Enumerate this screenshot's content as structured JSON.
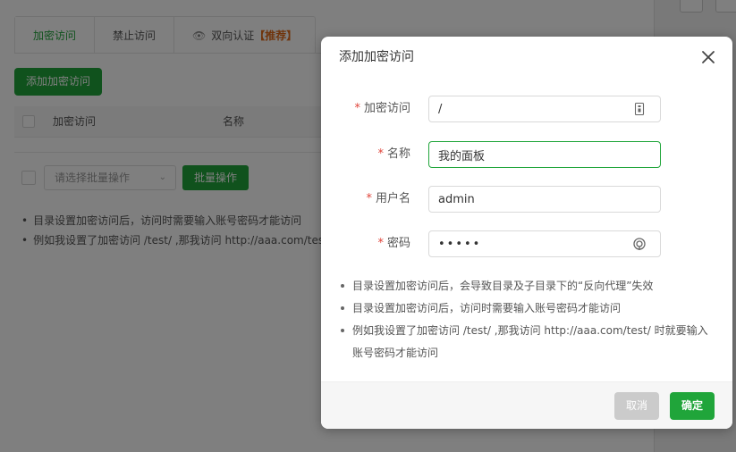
{
  "background": {
    "tabs": [
      {
        "label": "加密访问"
      },
      {
        "label": "禁止访问"
      },
      {
        "label": "双向认证",
        "badge": "【推荐】"
      }
    ],
    "add_button": "添加加密访问",
    "table": {
      "columns": [
        "加密访问",
        "名称"
      ]
    },
    "batch": {
      "select_placeholder": "请选择批量操作",
      "button": "批量操作"
    },
    "notes": [
      "目录设置加密访问后，访问时需要输入账号密码才能访问",
      "例如我设置了加密访问 /test/ ,那我访问 http://aaa.com/test/"
    ]
  },
  "dialog": {
    "title": "添加加密访问",
    "fields": {
      "path": {
        "label": "加密访问",
        "value": "/"
      },
      "name": {
        "label": "名称",
        "value": "我的面板"
      },
      "username": {
        "label": "用户名",
        "value": "admin"
      },
      "password": {
        "label": "密码",
        "value": "•••••"
      }
    },
    "notes": [
      "目录设置加密访问后，会导致目录及子目录下的“反向代理”失效",
      "目录设置加密访问后，访问时需要输入账号密码才能访问",
      "例如我设置了加密访问 /test/ ,那我访问 http://aaa.com/test/ 时就要输入账号密码才能访问"
    ],
    "cancel": "取消",
    "confirm": "确定"
  },
  "colors": {
    "accent": "#20a53a",
    "required": "#e0443a",
    "badge": "#e06b1a",
    "cancel_bg": "#cbcbcb"
  },
  "icons": {
    "path_field": "folder-icon",
    "password_field": "refresh-icon",
    "close": "close-icon",
    "tab_eye": "eye-icon"
  }
}
